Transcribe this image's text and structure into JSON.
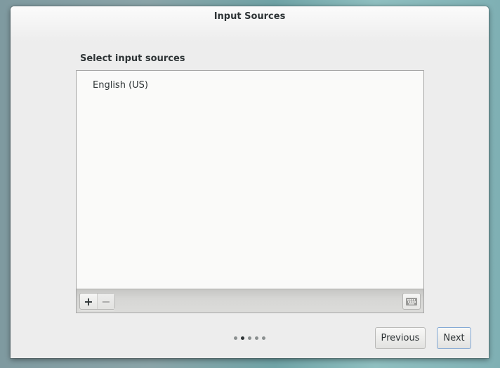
{
  "window": {
    "title": "Input Sources"
  },
  "main": {
    "section_label": "Select input sources",
    "input_sources": [
      {
        "label": "English (US)"
      }
    ],
    "toolbar": {
      "add_label": "+",
      "remove_label": "−",
      "add_icon": "plus-icon",
      "remove_icon": "minus-icon",
      "keyboard_icon": "keyboard-icon"
    }
  },
  "pager": {
    "total_pages": 5,
    "current_page": 2
  },
  "footer": {
    "previous_label": "Previous",
    "next_label": "Next"
  }
}
